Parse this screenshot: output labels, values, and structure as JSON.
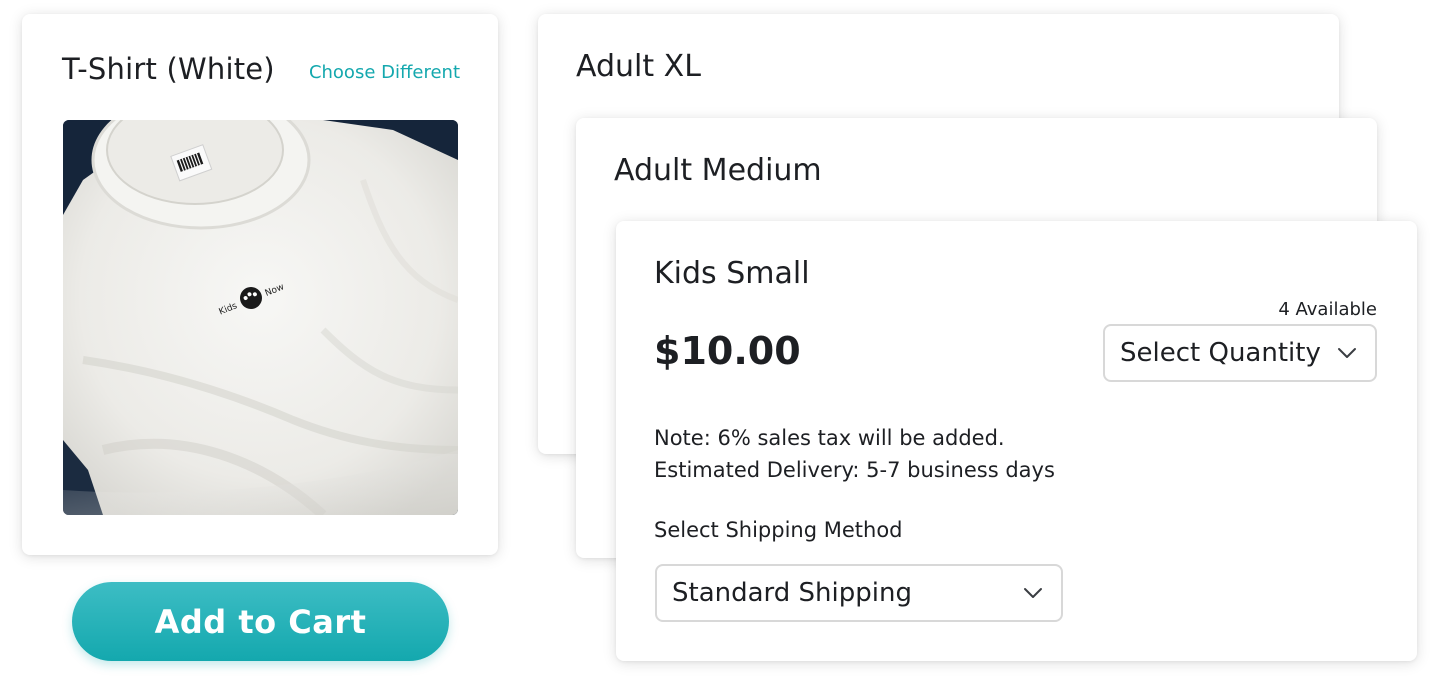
{
  "colors": {
    "accent": "#14a8ae",
    "text": "#1d1f23",
    "border": "#d8d8d8"
  },
  "product": {
    "title": "T-Shirt (White)",
    "choose_label": "Choose Different",
    "image_logo_left": "Kids",
    "image_logo_right": "Now"
  },
  "cart": {
    "add_label": "Add to Cart"
  },
  "sizes": [
    {
      "title": "Adult XL"
    },
    {
      "title": "Adult Medium"
    },
    {
      "title": "Kids Small",
      "price": "$10.00",
      "available": "4 Available",
      "quantity_select": "Select Quantity",
      "note_tax": "Note: 6% sales tax will be added.",
      "note_delivery": "Estimated Delivery: 5-7 business days",
      "shipping_label": "Select Shipping Method",
      "shipping_select": "Standard Shipping"
    }
  ],
  "icons": {
    "dropdown": "chevron-down-icon"
  }
}
